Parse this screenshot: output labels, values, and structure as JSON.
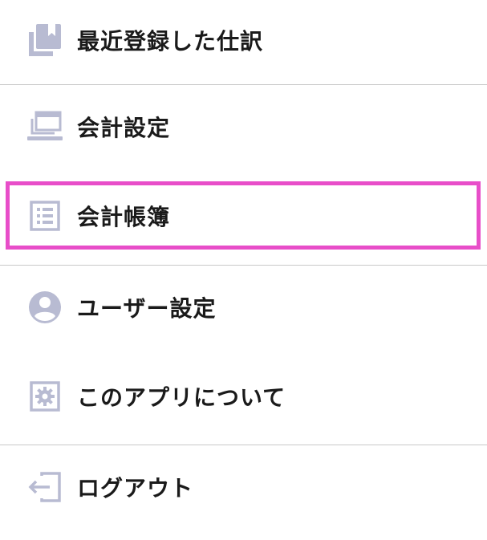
{
  "menu": {
    "items": [
      {
        "id": "recent-journals",
        "label": "最近登録した仕訳",
        "icon": "bookmark-book-icon"
      },
      {
        "id": "accounting-settings",
        "label": "会計設定",
        "icon": "laptop-window-icon"
      },
      {
        "id": "accounting-ledger",
        "label": "会計帳簿",
        "icon": "list-document-icon",
        "selected": true
      },
      {
        "id": "user-settings",
        "label": "ユーザー設定",
        "icon": "user-circle-icon"
      },
      {
        "id": "about-app",
        "label": "このアプリについて",
        "icon": "gear-square-icon"
      },
      {
        "id": "logout",
        "label": "ログアウト",
        "icon": "logout-arrow-icon"
      }
    ]
  },
  "colors": {
    "icon": "#b8bbd2",
    "text": "#1a1a1a",
    "divider": "#c8c8c8",
    "highlight": "#e84ec9"
  }
}
